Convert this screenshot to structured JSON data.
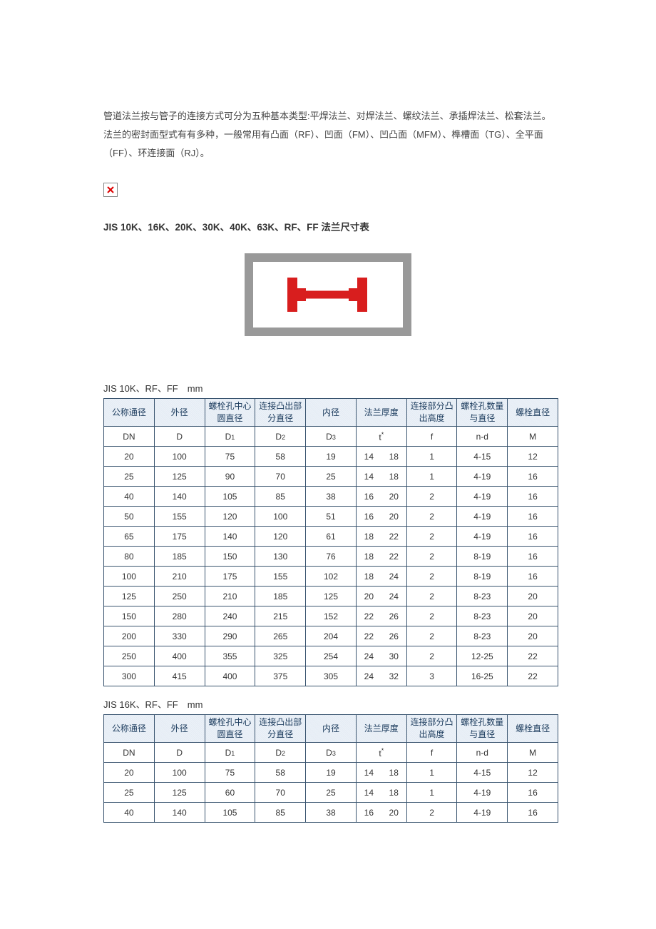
{
  "intro": "管道法兰按与管子的连接方式可分为五种基本类型:平焊法兰、对焊法兰、螺纹法兰、承插焊法兰、松套法兰。法兰的密封面型式有有多种，一般常用有凸面（RF）、凹面（FM）、凹凸面（MFM）、榫槽面（TG）、全平面（FF）、环连接面（RJ）。",
  "section_title": "JIS 10K、16K、20K、30K、40K、63K、RF、FF 法兰尺寸表",
  "table_headers": {
    "h1": "公称通径",
    "h2": "外径",
    "h3": "螺栓孔中心圆直径",
    "h4": "连接凸出部分直径",
    "h5": "内径",
    "h6": "法兰厚度",
    "h7": "连接部分凸出高度",
    "h8": "螺栓孔数量与直径",
    "h9": "螺栓直径",
    "s1": "DN",
    "s2": "D",
    "s3": "D",
    "s3_sub": "1",
    "s4": "D",
    "s4_sub": "2",
    "s5": "D",
    "s5_sub": "3",
    "s6": "t",
    "s6_sup": "*",
    "s7": "f",
    "s8": "n-d",
    "s9": "M"
  },
  "tables": [
    {
      "subheading": "JIS 10K、RF、FF　mm",
      "rows": [
        [
          "20",
          "100",
          "75",
          "58",
          "19",
          "14",
          "18",
          "1",
          "4-15",
          "12"
        ],
        [
          "25",
          "125",
          "90",
          "70",
          "25",
          "14",
          "18",
          "1",
          "4-19",
          "16"
        ],
        [
          "40",
          "140",
          "105",
          "85",
          "38",
          "16",
          "20",
          "2",
          "4-19",
          "16"
        ],
        [
          "50",
          "155",
          "120",
          "100",
          "51",
          "16",
          "20",
          "2",
          "4-19",
          "16"
        ],
        [
          "65",
          "175",
          "140",
          "120",
          "61",
          "18",
          "22",
          "2",
          "4-19",
          "16"
        ],
        [
          "80",
          "185",
          "150",
          "130",
          "76",
          "18",
          "22",
          "2",
          "8-19",
          "16"
        ],
        [
          "100",
          "210",
          "175",
          "155",
          "102",
          "18",
          "24",
          "2",
          "8-19",
          "16"
        ],
        [
          "125",
          "250",
          "210",
          "185",
          "125",
          "20",
          "24",
          "2",
          "8-23",
          "20"
        ],
        [
          "150",
          "280",
          "240",
          "215",
          "152",
          "22",
          "26",
          "2",
          "8-23",
          "20"
        ],
        [
          "200",
          "330",
          "290",
          "265",
          "204",
          "22",
          "26",
          "2",
          "8-23",
          "20"
        ],
        [
          "250",
          "400",
          "355",
          "325",
          "254",
          "24",
          "30",
          "2",
          "12-25",
          "22"
        ],
        [
          "300",
          "415",
          "400",
          "375",
          "305",
          "24",
          "32",
          "3",
          "16-25",
          "22"
        ]
      ]
    },
    {
      "subheading": "JIS 16K、RF、FF　mm",
      "rows": [
        [
          "20",
          "100",
          "75",
          "58",
          "19",
          "14",
          "18",
          "1",
          "4-15",
          "12"
        ],
        [
          "25",
          "125",
          "60",
          "70",
          "25",
          "14",
          "18",
          "1",
          "4-19",
          "16"
        ],
        [
          "40",
          "140",
          "105",
          "85",
          "38",
          "16",
          "20",
          "2",
          "4-19",
          "16"
        ]
      ]
    }
  ]
}
